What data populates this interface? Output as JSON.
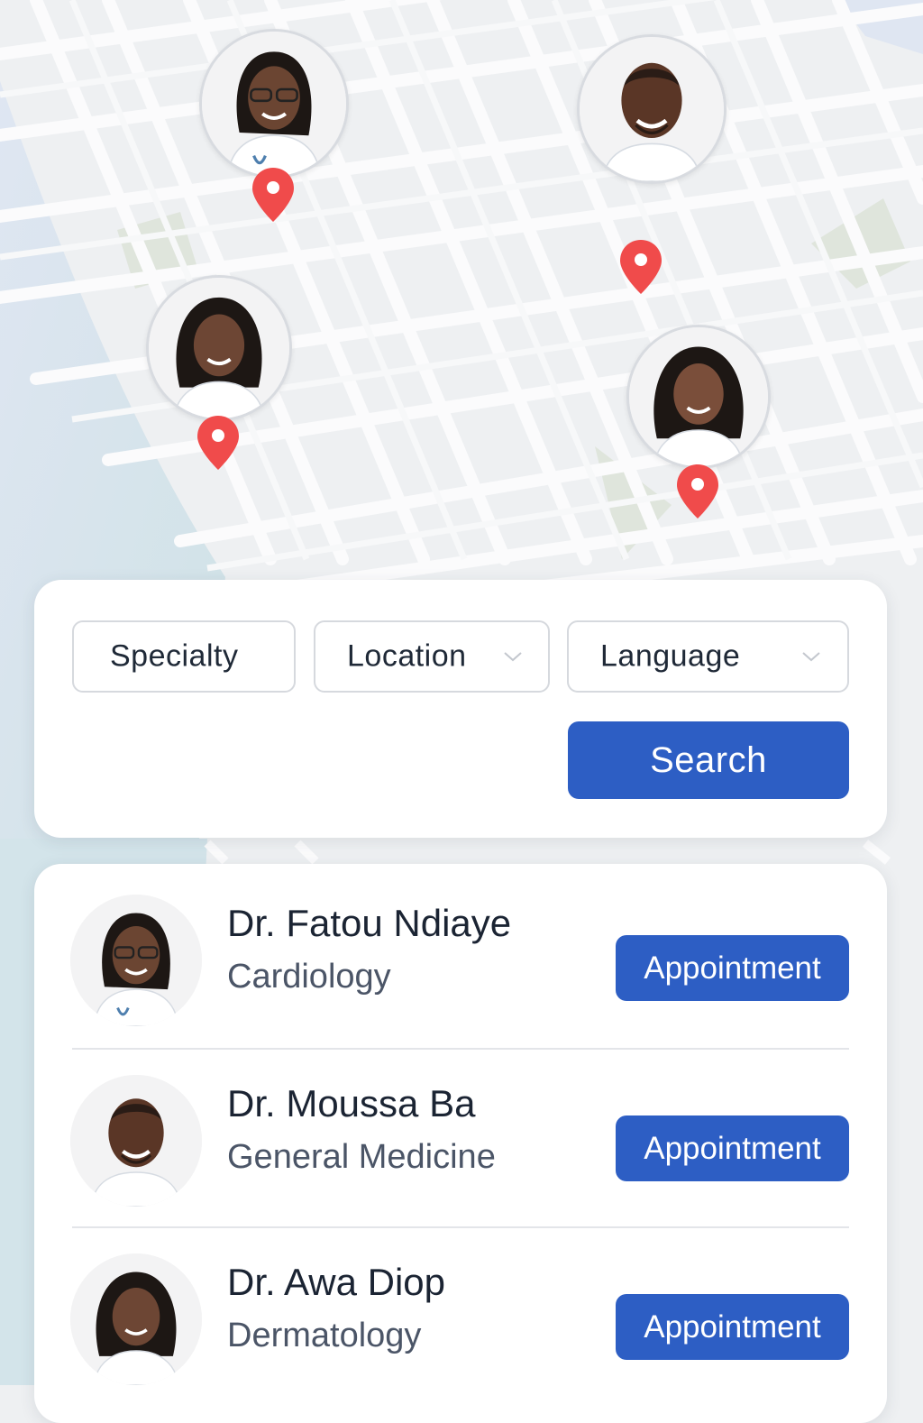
{
  "filters": {
    "specialty_label": "Specialty",
    "location_label": "Location",
    "language_label": "Language",
    "search_label": "Search"
  },
  "doctors": [
    {
      "name": "Dr. Fatou Ndiaye",
      "specialty": "Cardiology",
      "action": "Appointment"
    },
    {
      "name": "Dr. Moussa Ba",
      "specialty": "General Medicine",
      "action": "Appointment"
    },
    {
      "name": "Dr. Awa Diop",
      "specialty": "Dermatology",
      "action": "Appointment"
    }
  ],
  "colors": {
    "primary": "#2d5ec4",
    "pin": "#f04b4b",
    "map_background": "#eef0f2",
    "street": "#fbfbfc",
    "water": "#d3e4ea",
    "park": "#dfe5dc"
  },
  "map_markers": [
    {
      "icon": "map-pin-icon",
      "doctor": "Dr. Fatou Ndiaye"
    },
    {
      "icon": "map-pin-icon",
      "doctor": "Dr. Moussa Ba"
    },
    {
      "icon": "map-pin-icon",
      "doctor": "Dr. Awa Diop"
    },
    {
      "icon": "map-pin-icon",
      "doctor": ""
    }
  ]
}
